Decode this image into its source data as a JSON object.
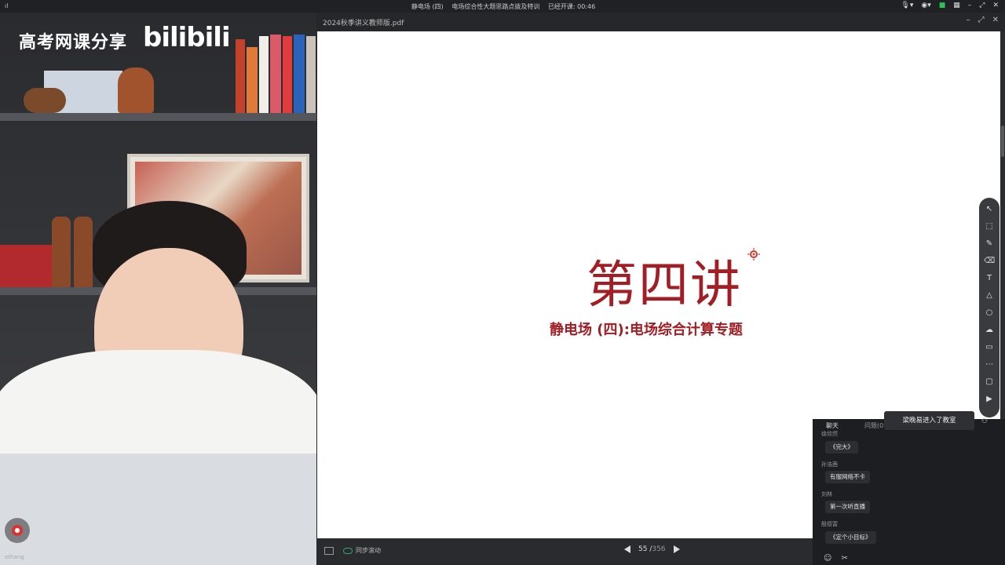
{
  "topbar": {
    "signal_icon": "signal-icon",
    "title_parts": [
      "静电场 (四)",
      "电场综合性大题思路点拨及特训",
      "已经开课: 00:46"
    ],
    "right_icons": [
      "mic-icon",
      "location-icon",
      "status-green-icon",
      "grid-icon",
      "minimize-icon",
      "restore-icon",
      "close-icon"
    ]
  },
  "camera": {
    "watermark": "高考网课分享",
    "brand": "bilibili",
    "presenter_name": "ethang"
  },
  "viewer": {
    "filename": "2024秋季讲义教师版.pdf",
    "slide_title": "第四讲",
    "slide_subtitle": "静电场 (四):电场综合计算专题",
    "sync_label": "同步滚动",
    "current_page": "55",
    "total_pages": "356"
  },
  "tools": [
    "cursor-icon",
    "select-icon",
    "pen-icon",
    "eraser-icon",
    "text-icon",
    "shape-icon",
    "circle-icon",
    "cloud-icon",
    "layout-icon",
    "grid-toggle-icon",
    "folder-icon",
    "video-icon"
  ],
  "chat": {
    "tab_chat": "聊天",
    "tab_questions": "问题(0",
    "toast": "梁晚易进入了教室",
    "messages": [
      {
        "user": "徐欣然",
        "text": "《完大》"
      },
      {
        "user": "孙浩茜",
        "text": "有服网络不卡"
      },
      {
        "user": "刘林",
        "text": "第一次听直播"
      },
      {
        "user": "殷德富",
        "text": "《定个小目标》"
      }
    ]
  }
}
